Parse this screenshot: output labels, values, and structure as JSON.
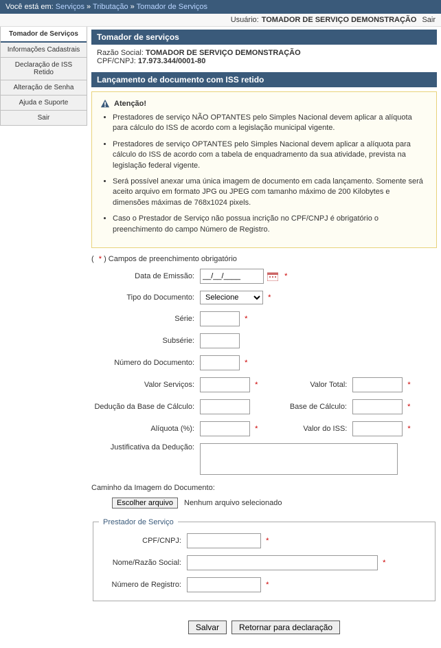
{
  "topbar": {
    "prefix": "Você está em:",
    "crumbs": [
      "Serviços",
      "Tributação",
      "Tomador de Serviços"
    ],
    "sep": " » "
  },
  "userbar": {
    "label": "Usuário:",
    "user": "TOMADOR DE SERVIÇO DEMONSTRAÇÃO",
    "exit": "Sair"
  },
  "sidebar": {
    "items": [
      {
        "label": "Tomador de Serviços",
        "selected": true
      },
      {
        "label": "Informações Cadastrais"
      },
      {
        "label": "Declaração de ISS Retido"
      },
      {
        "label": "Alteração de Senha"
      },
      {
        "label": "Ajuda e Suporte"
      },
      {
        "label": "Sair"
      }
    ]
  },
  "panel1": {
    "title": "Tomador de serviços",
    "razao_label": "Razão Social:",
    "razao_value": "TOMADOR DE SERVIÇO DEMONSTRAÇÃO",
    "cpf_label": "CPF/CNPJ:",
    "cpf_value": "17.973.344/0001-80"
  },
  "panel2": {
    "title": "Lançamento de documento com ISS retido"
  },
  "alert": {
    "heading": "Atenção!",
    "items": [
      "Prestadores de serviço NÃO OPTANTES pelo Simples Nacional devem aplicar a alíquota para cálculo do ISS de acordo com a legislação municipal vigente.",
      "Prestadores de serviço OPTANTES pelo Simples Nacional devem aplicar a alíquota para cálculo do ISS de acordo com a tabela de enquadramento da sua atividade, prevista na legislação federal vigente.",
      "Será possível anexar uma única imagem de documento em cada lançamento. Somente será aceito arquivo em formato JPG ou JPEG com tamanho máximo de 200 Kilobytes e dimensões máximas de 768x1024 pixels.",
      "Caso o Prestador de Serviço não possua incrição no CPF/CNPJ é obrigatório o preenchimento do campo Número de Registro."
    ]
  },
  "req_note": "Campos de preenchimento obrigatório",
  "form": {
    "data_emissao": {
      "label": "Data de Emissão:",
      "value": "__/__/____"
    },
    "tipo_doc": {
      "label": "Tipo do Documento:",
      "selected": "Selecione"
    },
    "serie": {
      "label": "Série:"
    },
    "subserie": {
      "label": "Subsérie:"
    },
    "num_doc": {
      "label": "Número do Documento:"
    },
    "valor_servicos": {
      "label": "Valor Serviços:"
    },
    "valor_total": {
      "label": "Valor Total:"
    },
    "deducao": {
      "label": "Dedução da Base de Cálculo:"
    },
    "base_calculo": {
      "label": "Base de Cálculo:"
    },
    "aliquota": {
      "label": "Alíquota (%):"
    },
    "valor_iss": {
      "label": "Valor do ISS:"
    },
    "justificativa": {
      "label": "Justificativa da Dedução:"
    },
    "caminho": {
      "label": "Caminho da Imagem do Documento:"
    },
    "file_btn": "Escolher arquivo",
    "file_status": "Nenhum arquivo selecionado"
  },
  "prestador": {
    "legend": "Prestador de Serviço",
    "cpf": {
      "label": "CPF/CNPJ:"
    },
    "nome": {
      "label": "Nome/Razão Social:"
    },
    "registro": {
      "label": "Número de Registro:"
    }
  },
  "buttons": {
    "salvar": "Salvar",
    "retornar": "Retornar para declaração"
  }
}
